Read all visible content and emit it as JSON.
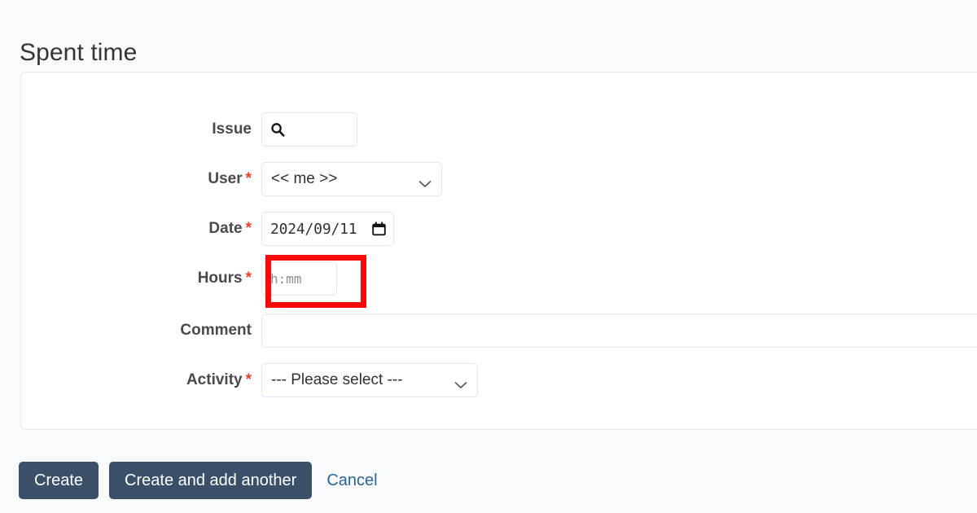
{
  "page": {
    "title": "Spent time",
    "background_color": "#f9fafc",
    "accent_color": "#3a5069",
    "required_marker_color": "#e8402a",
    "highlight_color": "#fa0a08",
    "link_color": "#2a6496"
  },
  "form": {
    "required_marker": "*",
    "fields": {
      "issue": {
        "label": "Issue",
        "required": false,
        "value": "",
        "placeholder": "",
        "icon": "search-icon"
      },
      "user": {
        "label": "User",
        "required": true,
        "selected": "<< me >>",
        "icon": "chevron-down-icon"
      },
      "date": {
        "label": "Date",
        "required": true,
        "value": "2024/09/11",
        "icon": "calendar-icon"
      },
      "hours": {
        "label": "Hours",
        "required": true,
        "value": "",
        "placeholder": "h:mm",
        "highlighted": true
      },
      "comment": {
        "label": "Comment",
        "required": false,
        "value": "",
        "placeholder": ""
      },
      "activity": {
        "label": "Activity",
        "required": true,
        "selected": "--- Please select ---",
        "icon": "chevron-down-icon"
      }
    }
  },
  "actions": {
    "create_label": "Create",
    "create_and_add_another_label": "Create and add another",
    "cancel_label": "Cancel"
  }
}
